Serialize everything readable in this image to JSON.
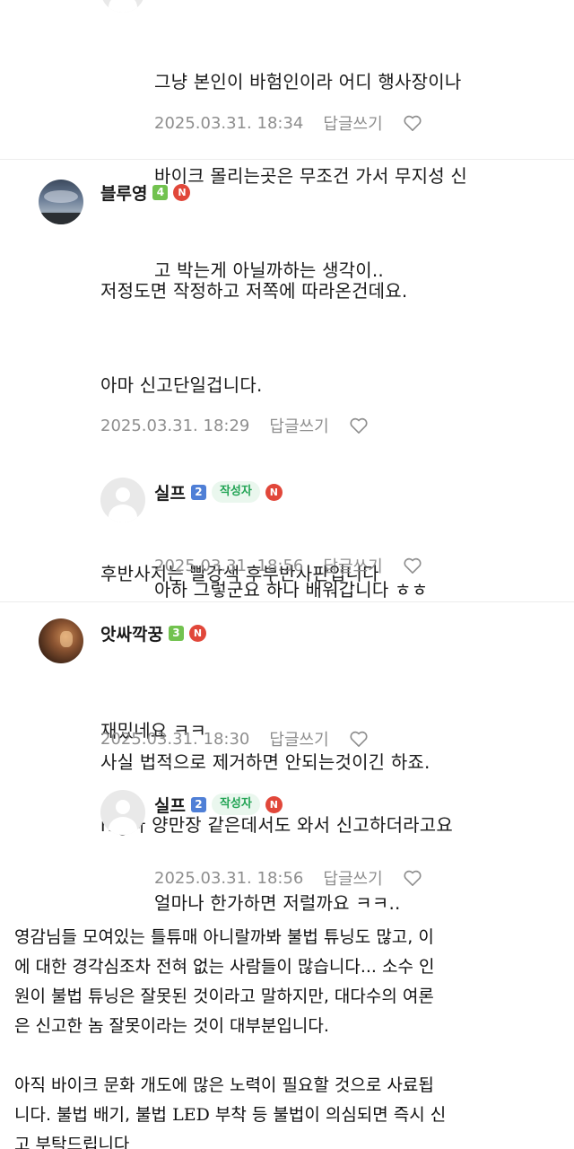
{
  "comments": [
    {
      "id": "c0",
      "lines": [
        "그냥 본인이 바험인이라 어디 행사장이나",
        "바이크 몰리는곳은 무조건 가서 무지성 신",
        "고 박는게 아닐까하는 생각이.."
      ],
      "date": "2025.03.31. 18:34",
      "reply_label": "답글쓰기",
      "like_icon": "heart-outline-icon"
    },
    {
      "id": "c1",
      "nickname": "블루영",
      "level": "4",
      "level_color": "#72c24f",
      "new_badge": "N",
      "lines": [
        "저정도면 작정하고 저쪽에 따라온건데요.",
        "아마 신고단일겁니다.",
        "",
        "후반사지는 빨강색 후부반사판입니다",
        "",
        "사실 법적으로 제거하면 안되는것이긴 하죠."
      ],
      "date": "2025.03.31. 18:29",
      "reply_label": "답글쓰기"
    },
    {
      "id": "c2",
      "nickname": "실프",
      "level": "2",
      "level_color": "#4f7fd6",
      "writer_badge": "작성자",
      "new_badge": "N",
      "lines": [
        "아하 그렇군요 하나 배워갑니다 ㅎㅎ"
      ],
      "date": "2025.03.31. 18:56",
      "reply_label": "답글쓰기"
    },
    {
      "id": "c3",
      "nickname": "앗싸깍꿍",
      "level": "3",
      "level_color": "#72c24f",
      "new_badge": "N",
      "lines": [
        "재밌네요 ㅋㅋ",
        "rsg나 양만장 같은데서도 와서 신고하더라고요"
      ],
      "date": "2025.03.31. 18:30",
      "reply_label": "답글쓰기"
    },
    {
      "id": "c4",
      "nickname": "실프",
      "level": "2",
      "level_color": "#4f7fd6",
      "writer_badge": "작성자",
      "new_badge": "N",
      "lines": [
        "얼마나 한가하면 저럴까요 ㅋㅋ.."
      ],
      "date": "2025.03.31. 18:56",
      "reply_label": "답글쓰기"
    }
  ],
  "article": {
    "para1": [
      "영감님들 모여있는 틀튜매 아니랄까봐 불법 튜닝도 많고, 이",
      "에 대한 경각심조차 전혀 없는 사람들이 많습니다... 소수 인",
      "원이 불법 튜닝은 잘못된 것이라고 말하지만, 대다수의 여론",
      "은 신고한 놈 잘못이라는 것이 대부분입니다."
    ],
    "para2_line1": "아직 바이크 문화 개도에 많은 노력이 필요할 것으로 사료됩",
    "para2_line2_a": "니다. 불법 배기, 불법 ",
    "para2_line2_led": "LED",
    "para2_line2_b": " 부착 등 불법이 의심되면 즉시 신",
    "para2_line3": "고 부탁드립니다"
  }
}
